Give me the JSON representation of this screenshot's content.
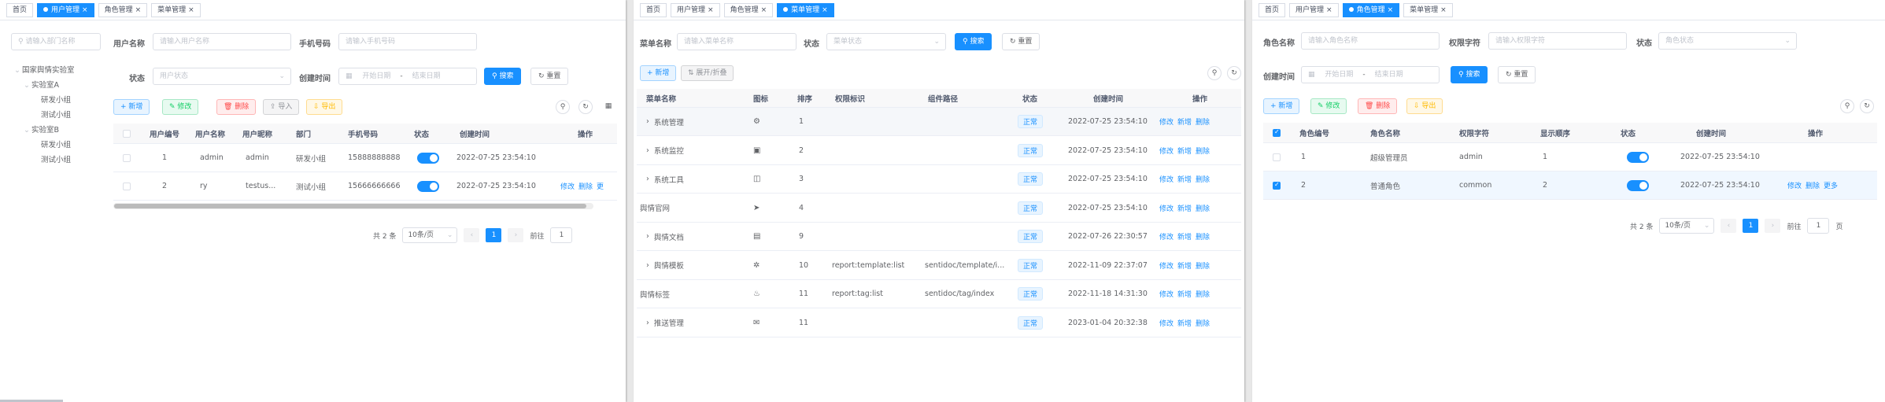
{
  "panel1": {
    "tabs": [
      {
        "label": "首页",
        "active": false
      },
      {
        "label": "用户管理",
        "active": true
      },
      {
        "label": "角色管理",
        "active": false
      },
      {
        "label": "菜单管理",
        "active": false
      }
    ],
    "dept_search_placeholder": "请输入部门名称",
    "tree": [
      {
        "label": "国家舆情实验室",
        "arrow": "⌄"
      },
      {
        "label": "实验室A",
        "arrow": "⌄"
      },
      {
        "label": "研发小组",
        "arrow": ""
      },
      {
        "label": "测试小组",
        "arrow": ""
      },
      {
        "label": "实验室B",
        "arrow": "⌄"
      },
      {
        "label": "研发小组",
        "arrow": ""
      },
      {
        "label": "测试小组",
        "arrow": ""
      }
    ],
    "form": {
      "username_label": "用户名称",
      "username_placeholder": "请输入用户名称",
      "phone_label": "手机号码",
      "phone_placeholder": "请输入手机号码",
      "status_label": "状态",
      "status_placeholder": "用户状态",
      "time_label": "创建时间",
      "start_placeholder": "开始日期",
      "dash": "-",
      "end_placeholder": "结束日期",
      "search": "搜索",
      "reset": "重置"
    },
    "toolbar": {
      "add": "新增",
      "edit": "修改",
      "delete": "删除",
      "import": "导入",
      "export": "导出"
    },
    "columns": [
      "用户编号",
      "用户名称",
      "用户昵称",
      "部门",
      "手机号码",
      "状态",
      "创建时间",
      "操作"
    ],
    "rows": [
      {
        "id": "1",
        "username": "admin",
        "nickname": "admin",
        "dept": "研发小组",
        "phone": "15888888888",
        "time": "2022-07-25 23:54:10",
        "ops": []
      },
      {
        "id": "2",
        "username": "ry",
        "nickname": "testus...",
        "dept": "测试小组",
        "phone": "15666666666",
        "time": "2022-07-25 23:54:10",
        "ops": [
          "修改",
          "删除",
          "更"
        ]
      }
    ],
    "pager": {
      "total": "共 2 条",
      "size": "10条/页",
      "page": "1",
      "goto": "前往",
      "goto_val": "1"
    }
  },
  "panel2": {
    "tabs": [
      {
        "label": "首页",
        "active": false
      },
      {
        "label": "用户管理",
        "active": false
      },
      {
        "label": "角色管理",
        "active": false
      },
      {
        "label": "菜单管理",
        "active": true
      }
    ],
    "form": {
      "menu_label": "菜单名称",
      "menu_placeholder": "请输入菜单名称",
      "status_label": "状态",
      "status_placeholder": "菜单状态",
      "search": "搜索",
      "reset": "重置"
    },
    "toolbar": {
      "add": "新增",
      "expand": "展开/折叠"
    },
    "columns": [
      "菜单名称",
      "图标",
      "排序",
      "权限标识",
      "组件路径",
      "状态",
      "创建时间",
      "操作"
    ],
    "rows": [
      {
        "name": "系统管理",
        "arrow": true,
        "icon": "⚙",
        "sort": "1",
        "perm": "",
        "path": "",
        "status": "正常",
        "time": "2022-07-25 23:54:10",
        "ops": [
          "修改",
          "新增",
          "删除"
        ]
      },
      {
        "name": "系统监控",
        "arrow": true,
        "icon": "▣",
        "sort": "2",
        "perm": "",
        "path": "",
        "status": "正常",
        "time": "2022-07-25 23:54:10",
        "ops": [
          "修改",
          "新增",
          "删除"
        ]
      },
      {
        "name": "系统工具",
        "arrow": true,
        "icon": "◫",
        "sort": "3",
        "perm": "",
        "path": "",
        "status": "正常",
        "time": "2022-07-25 23:54:10",
        "ops": [
          "修改",
          "新增",
          "删除"
        ]
      },
      {
        "name": "舆情官网",
        "arrow": false,
        "icon": "➤",
        "sort": "4",
        "perm": "",
        "path": "",
        "status": "正常",
        "time": "2022-07-25 23:54:10",
        "ops": [
          "修改",
          "新增",
          "删除"
        ]
      },
      {
        "name": "舆情文档",
        "arrow": true,
        "icon": "▤",
        "sort": "9",
        "perm": "",
        "path": "",
        "status": "正常",
        "time": "2022-07-26 22:30:57",
        "ops": [
          "修改",
          "新增",
          "删除"
        ]
      },
      {
        "name": "舆情模板",
        "arrow": true,
        "icon": "✲",
        "sort": "10",
        "perm": "report:template:list",
        "path": "sentidoc/template/i...",
        "status": "正常",
        "time": "2022-11-09 22:37:07",
        "ops": [
          "修改",
          "新增",
          "删除"
        ]
      },
      {
        "name": "舆情标签",
        "arrow": false,
        "icon": "♨",
        "sort": "11",
        "perm": "report:tag:list",
        "path": "sentidoc/tag/index",
        "status": "正常",
        "time": "2022-11-18 14:31:30",
        "ops": [
          "修改",
          "新增",
          "删除"
        ]
      },
      {
        "name": "推送管理",
        "arrow": true,
        "icon": "✉",
        "sort": "11",
        "perm": "",
        "path": "",
        "status": "正常",
        "time": "2023-01-04 20:32:38",
        "ops": [
          "修改",
          "新增",
          "删除"
        ]
      }
    ]
  },
  "panel3": {
    "tabs": [
      {
        "label": "首页",
        "active": false
      },
      {
        "label": "用户管理",
        "active": false
      },
      {
        "label": "角色管理",
        "active": true
      },
      {
        "label": "菜单管理",
        "active": false
      }
    ],
    "form": {
      "role_label": "角色名称",
      "role_placeholder": "请输入角色名称",
      "perm_label": "权限字符",
      "perm_placeholder": "请输入权限字符",
      "status_label": "状态",
      "status_placeholder": "角色状态",
      "time_label": "创建时间",
      "start_placeholder": "开始日期",
      "dash": "-",
      "end_placeholder": "结束日期",
      "search": "搜索",
      "reset": "重置"
    },
    "toolbar": {
      "add": "新增",
      "edit": "修改",
      "delete": "删除",
      "export": "导出"
    },
    "columns": [
      "角色编号",
      "角色名称",
      "权限字符",
      "显示顺序",
      "状态",
      "创建时间",
      "操作"
    ],
    "rows": [
      {
        "id": "1",
        "name": "超级管理员",
        "key": "admin",
        "order": "1",
        "time": "2022-07-25 23:54:10",
        "checked": false,
        "ops": []
      },
      {
        "id": "2",
        "name": "普通角色",
        "key": "common",
        "order": "2",
        "time": "2022-07-25 23:54:10",
        "checked": true,
        "ops": [
          "修改",
          "删除",
          "更多"
        ]
      }
    ],
    "pager": {
      "total": "共 2 条",
      "size": "10条/页",
      "page": "1",
      "goto": "前往",
      "goto_val": "1",
      "unit": "页"
    }
  },
  "colors": {
    "primary": "#1890ff",
    "success": "#13ce66",
    "danger": "#ff4949",
    "warning": "#ffba00"
  }
}
